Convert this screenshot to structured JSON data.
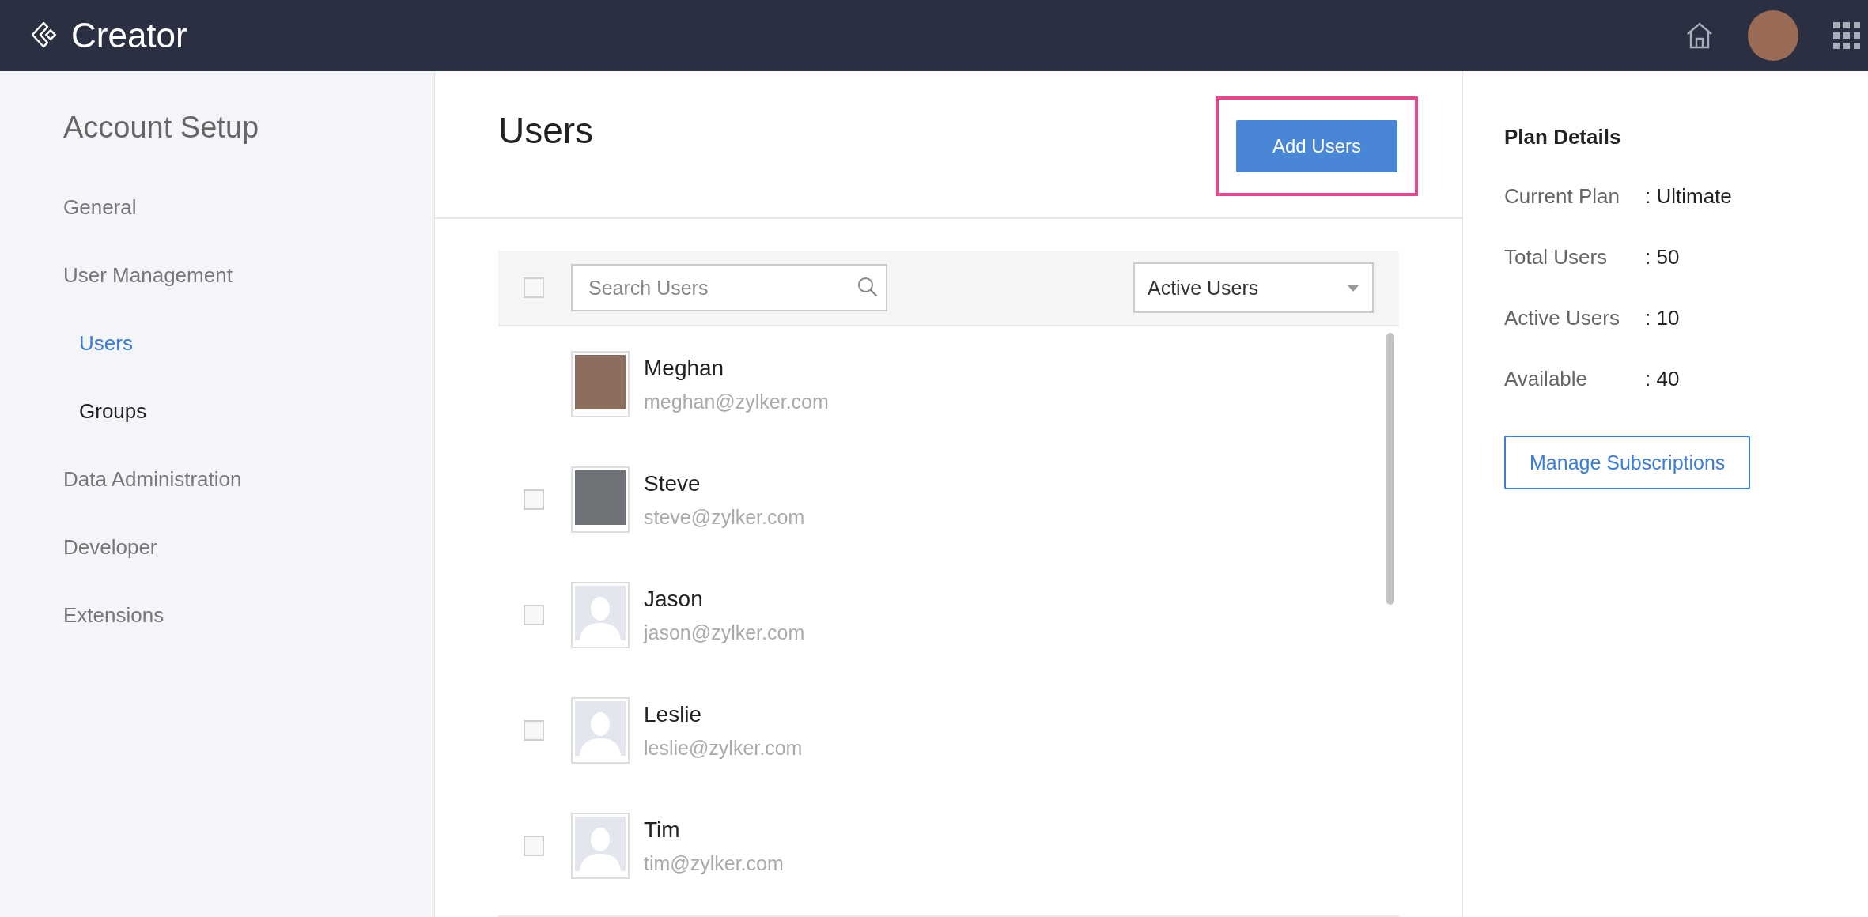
{
  "topbar": {
    "logo": "Creator"
  },
  "sidebar": {
    "title": "Account Setup",
    "items": [
      {
        "label": "General",
        "selected": false
      },
      {
        "label": "User Management",
        "selected": false,
        "children": [
          {
            "label": "Users",
            "selected": true
          },
          {
            "label": "Groups",
            "selected": false
          }
        ]
      },
      {
        "label": "Data Administration",
        "selected": false
      },
      {
        "label": "Developer",
        "selected": false
      },
      {
        "label": "Extensions",
        "selected": false
      }
    ]
  },
  "users": {
    "title": "Users",
    "add_button": "Add Users",
    "add_button_highlighted": true,
    "select_all": {
      "checked": false
    },
    "search": {
      "placeholder": "Search Users"
    },
    "filter": {
      "value": "Active Users"
    },
    "rows": [
      {
        "name": "Meghan",
        "email": "meghan@zylker.com",
        "kind": "photo",
        "selectable": false
      },
      {
        "name": "Steve",
        "email": "steve@zylker.com",
        "kind": "photo",
        "selectable": true,
        "checked": false
      },
      {
        "name": "Jason",
        "email": "jason@zylker.com",
        "kind": "silhouette",
        "selectable": true,
        "checked": false
      },
      {
        "name": "Leslie",
        "email": "leslie@zylker.com",
        "kind": "silhouette",
        "selectable": true,
        "checked": false
      },
      {
        "name": "Tim",
        "email": "tim@zylker.com",
        "kind": "silhouette",
        "selectable": true,
        "checked": false
      }
    ]
  },
  "plan": {
    "title": "Plan Details",
    "rows": [
      {
        "label": "Current Plan",
        "value": ": Ultimate"
      },
      {
        "label": "Total Users",
        "value": ": 50"
      },
      {
        "label": "Active Users",
        "value": ": 10"
      },
      {
        "label": "Available",
        "value": ": 40"
      }
    ],
    "button": "Manage Subscriptions"
  }
}
